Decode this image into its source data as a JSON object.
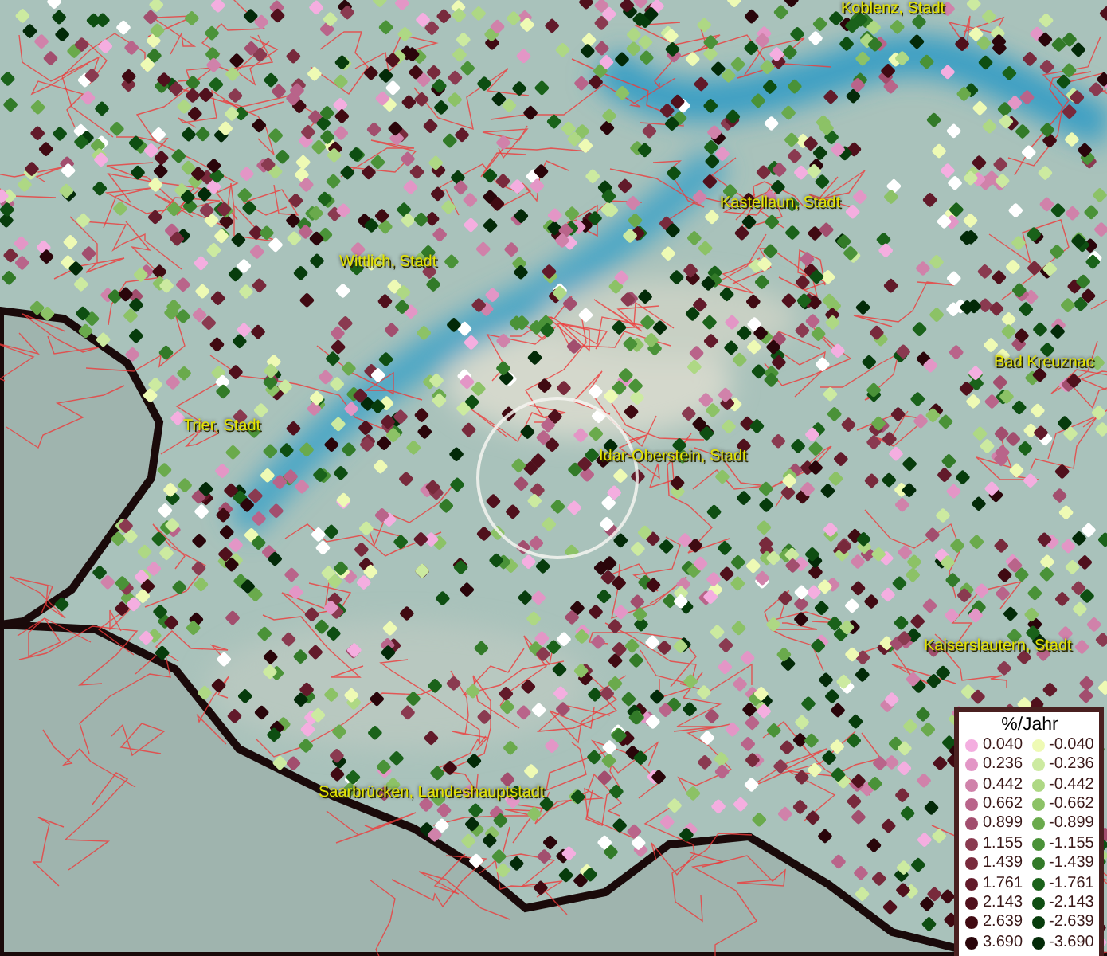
{
  "map": {
    "places": [
      {
        "name": "Koblenz, Stadt"
      },
      {
        "name": "Kastellaun, Stadt"
      },
      {
        "name": "Wittlich, Stadt"
      },
      {
        "name": "Bad Kreuznac"
      },
      {
        "name": "Trier, Stadt"
      },
      {
        "name": "Idar-Oberstein, Stadt"
      },
      {
        "name": "Kaiserslautern, Stadt"
      },
      {
        "name": "Saarbrücken, Landeshauptstadt"
      }
    ]
  },
  "legend": {
    "title": "%/Jahr",
    "positive": [
      {
        "value": "0.040",
        "color": "#f4aee0"
      },
      {
        "value": "0.236",
        "color": "#e396c6"
      },
      {
        "value": "0.442",
        "color": "#d082aa"
      },
      {
        "value": "0.662",
        "color": "#b9648a"
      },
      {
        "value": "0.899",
        "color": "#a24e6e"
      },
      {
        "value": "1.155",
        "color": "#8a3a50"
      },
      {
        "value": "1.439",
        "color": "#782a3c"
      },
      {
        "value": "1.761",
        "color": "#621a2a"
      },
      {
        "value": "2.143",
        "color": "#50101c"
      },
      {
        "value": "2.639",
        "color": "#400a12"
      },
      {
        "value": "3.690",
        "color": "#2a050a"
      }
    ],
    "negative": [
      {
        "value": "-0.040",
        "color": "#eefab4"
      },
      {
        "value": "-0.236",
        "color": "#cceaa0"
      },
      {
        "value": "-0.442",
        "color": "#aed884"
      },
      {
        "value": "-0.662",
        "color": "#8cc266"
      },
      {
        "value": "-0.899",
        "color": "#6aaa4c"
      },
      {
        "value": "-1.155",
        "color": "#4a9238"
      },
      {
        "value": "-1.439",
        "color": "#327a28"
      },
      {
        "value": "-1.761",
        "color": "#1a621a"
      },
      {
        "value": "-2.143",
        "color": "#0e4e12"
      },
      {
        "value": "-2.639",
        "color": "#073c0c"
      },
      {
        "value": "-3.690",
        "color": "#032a08"
      }
    ]
  }
}
